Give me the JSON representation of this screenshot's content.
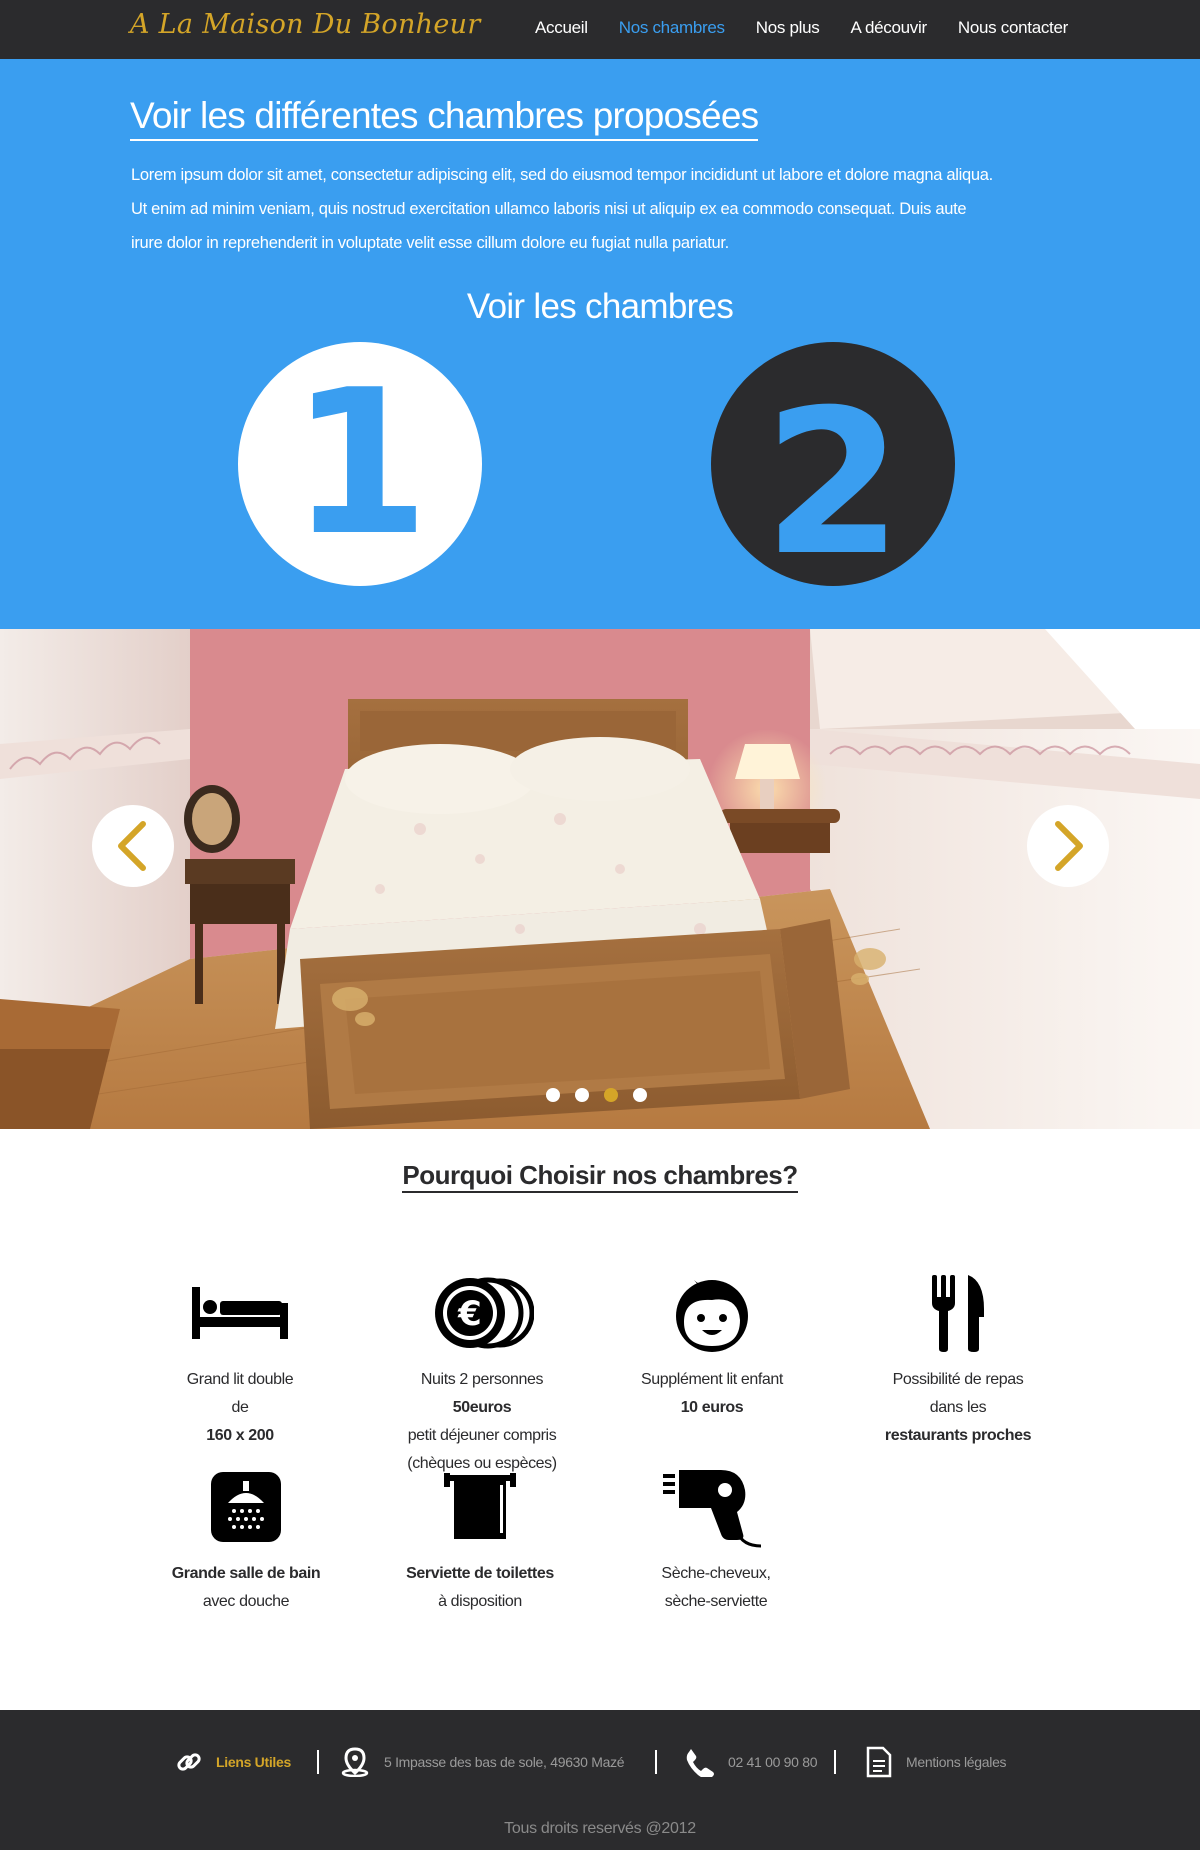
{
  "brand": "A La Maison Du Bonheur",
  "nav": [
    {
      "label": "Accueil",
      "active": false
    },
    {
      "label": "Nos chambres",
      "active": true
    },
    {
      "label": "Nos plus",
      "active": false
    },
    {
      "label": "A découvir",
      "active": false
    },
    {
      "label": "Nous contacter",
      "active": false
    }
  ],
  "hero": {
    "title": "Voir les différentes chambres proposées",
    "paragraph": [
      "Lorem ipsum dolor sit amet, consectetur adipiscing elit, sed do eiusmod tempor incididunt ut labore et dolore magna aliqua.",
      "Ut enim ad minim veniam, quis nostrud exercitation ullamco laboris nisi ut aliquip ex ea commodo consequat. Duis aute",
      " irure dolor in reprehenderit in voluptate velit esse cillum dolore eu fugiat nulla pariatur."
    ],
    "rooms_heading": "Voir les chambres",
    "room_buttons": [
      "1",
      "2"
    ]
  },
  "carousel": {
    "slide_count": 4,
    "active_slide": 3
  },
  "why": {
    "title": "Pourquoi Choisir nos chambres?",
    "features": [
      {
        "icon": "bed-icon",
        "lines": [
          [
            {
              "t": "Grand lit double",
              "b": false
            }
          ],
          [
            {
              "t": "de ",
              "b": false
            },
            {
              "t": "160 x 200",
              "b": true
            }
          ]
        ]
      },
      {
        "icon": "euro-coins-icon",
        "lines": [
          [
            {
              "t": "Nuits 2 personnes ",
              "b": false
            },
            {
              "t": "50euros",
              "b": true
            }
          ],
          [
            {
              "t": "petit déjeuner compris",
              "b": false
            }
          ],
          [
            {
              "t": "(chèques ou espèces)",
              "b": false
            }
          ]
        ]
      },
      {
        "icon": "child-face-icon",
        "lines": [
          [
            {
              "t": "Supplément lit enfant",
              "b": false
            }
          ],
          [
            {
              "t": "10 euros",
              "b": true
            }
          ]
        ]
      },
      {
        "icon": "fork-knife-icon",
        "lines": [
          [
            {
              "t": "Possibilité de repas",
              "b": false
            }
          ],
          [
            {
              "t": "dans les ",
              "b": false
            },
            {
              "t": "restaurants proches",
              "b": true
            }
          ]
        ]
      },
      {
        "icon": "shower-icon",
        "lines": [
          [
            {
              "t": "Grande salle de bain",
              "b": true
            }
          ],
          [
            {
              "t": "avec douche",
              "b": false
            }
          ]
        ]
      },
      {
        "icon": "towel-icon",
        "lines": [
          [
            {
              "t": "Serviette de toilettes",
              "b": true
            }
          ],
          [
            {
              "t": "à disposition",
              "b": false
            }
          ]
        ]
      },
      {
        "icon": "hair-dryer-icon",
        "lines": [
          [
            {
              "t": "Sèche-cheveux,",
              "b": false
            }
          ],
          [
            {
              "t": "sèche-serviette",
              "b": false
            }
          ]
        ]
      }
    ]
  },
  "footer": {
    "links_label": "Liens Utiles",
    "address": "5 Impasse des bas de sole, 49630 Mazé",
    "phone": "02 41 00 90 80",
    "legal": "Mentions légales",
    "copyright": "Tous droits reservés @2012"
  },
  "colors": {
    "accent_blue": "#3a9ef0",
    "dark": "#2b2b2d",
    "gold": "#d4a528"
  }
}
